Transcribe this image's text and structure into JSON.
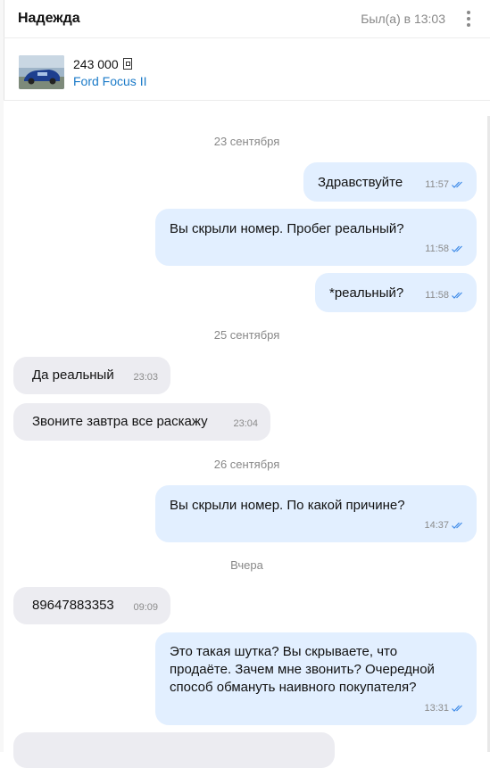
{
  "header": {
    "contact_name": "Надежда",
    "last_seen": "Был(а) в 13:03"
  },
  "listing": {
    "price": "243 000",
    "car_title": "Ford Focus II"
  },
  "colors": {
    "outgoing_bubble": "#e2efff",
    "incoming_bubble": "#ececf1",
    "link": "#1a7ac8",
    "read_ticks": "#3d8ae8"
  },
  "chat": {
    "dates": [
      "23 сентября",
      "25 сентября",
      "26 сентября",
      "Вчера"
    ],
    "messages": [
      {
        "direction": "out",
        "text": "Здравствуйте",
        "time": "11:57",
        "read": true
      },
      {
        "direction": "out",
        "text": "Вы скрыли номер. Пробег реальный?",
        "time": "11:58",
        "read": true
      },
      {
        "direction": "out",
        "text": "*реальный?",
        "time": "11:58",
        "read": true
      },
      {
        "direction": "in",
        "text": "Да реальный",
        "time": "23:03"
      },
      {
        "direction": "in",
        "text": "Звоните завтра все раскажу",
        "time": "23:04"
      },
      {
        "direction": "out",
        "text": "Вы скрыли номер. По какой причине?",
        "time": "14:37",
        "read": true
      },
      {
        "direction": "in",
        "text": "89647883353",
        "time": "09:09"
      },
      {
        "direction": "out",
        "text": "Это такая шутка? Вы скрываете, что продаёте. Зачем мне звонить? Очередной способ обмануть наивного покупателя?",
        "time": "13:31",
        "read": true
      }
    ]
  }
}
